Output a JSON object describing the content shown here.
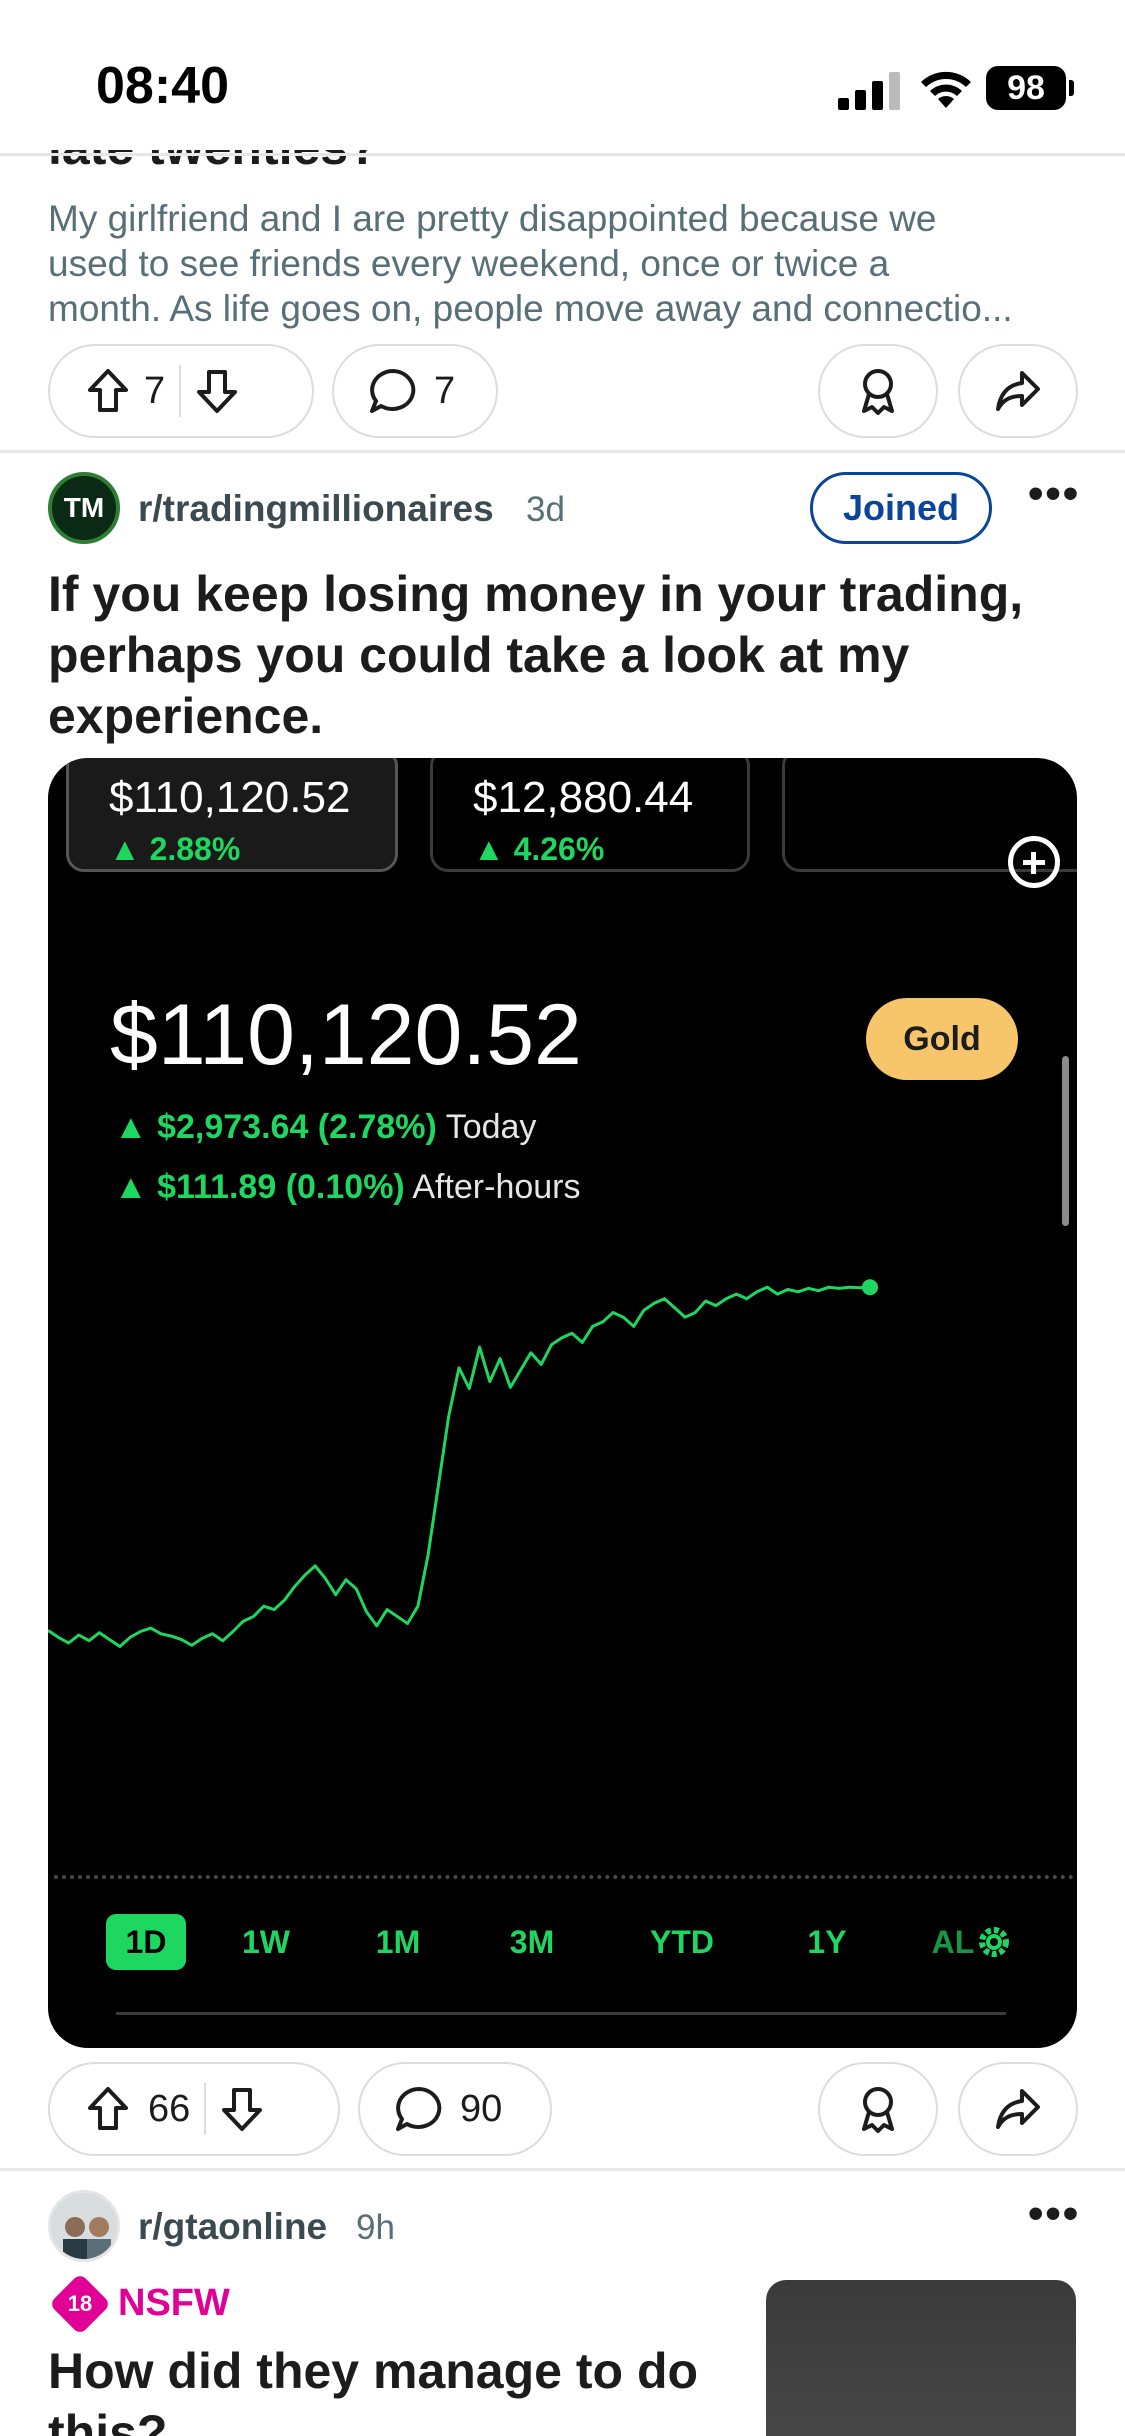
{
  "status_bar": {
    "time": "08:40",
    "battery": "98"
  },
  "post1": {
    "title_fragment": "late twenties?",
    "body_lines": [
      "My girlfriend and I are pretty disappointed because we",
      "used to see friends every weekend, once or twice a",
      "month. As life goes on, people move away and connectio..."
    ],
    "upvotes": "7",
    "comments": "7"
  },
  "post2": {
    "avatar_text": "TM",
    "subreddit": "r/tradingmillionaires",
    "time": "3d",
    "joined_label": "Joined",
    "more": "•••",
    "title": "If you keep losing money in your trading, perhaps you could take a look at my experience.",
    "upvotes": "66",
    "comments": "90",
    "image": {
      "accounts": [
        {
          "value": "$110,120.52",
          "change": "▲ 2.88%"
        },
        {
          "value": "$12,880.44",
          "change": "▲ 4.26%"
        }
      ],
      "balance": "$110,120.52",
      "tier_label": "Gold",
      "today_change": "▲ $2,973.64 (2.78%)",
      "today_label": "Today",
      "afterhours_change": "▲ $111.89 (0.10%)",
      "afterhours_label": "After-hours",
      "ranges": [
        "1D",
        "1W",
        "1M",
        "3M",
        "YTD",
        "1Y",
        "AL"
      ],
      "colors": {
        "up": "#1ed760",
        "gold": "#f7c66b",
        "background": "#000000"
      }
    }
  },
  "post3": {
    "subreddit": "r/gtaonline",
    "time": "9h",
    "more": "•••",
    "nsfw_badge": "18",
    "nsfw_label": "NSFW",
    "title": "How did they manage to do this?"
  },
  "colors": {
    "joined": "#0a449b",
    "nsfw": "#e00096",
    "meta": "#576f76"
  },
  "chart_data": {
    "type": "line",
    "title": "",
    "x": [
      0,
      1,
      2,
      3,
      4,
      5,
      6,
      7,
      8,
      9,
      10,
      11,
      12,
      13,
      14,
      15,
      16,
      17,
      18,
      19,
      20,
      21,
      22,
      23,
      24,
      25,
      26,
      27,
      28,
      29,
      30,
      31,
      32,
      33,
      34,
      35,
      36,
      37,
      38,
      39,
      40,
      41,
      42,
      43,
      44,
      45,
      46,
      47,
      48,
      49,
      50,
      51,
      52,
      53,
      54,
      55,
      56,
      57,
      58,
      59,
      60,
      61,
      62,
      63,
      64,
      65,
      66,
      67,
      68,
      69,
      70,
      71,
      72,
      73,
      74,
      75,
      76,
      77,
      78,
      79,
      80
    ],
    "series": [
      {
        "values": [
          107140,
          107080,
          107030,
          107100,
          107050,
          107120,
          107060,
          107000,
          107080,
          107130,
          107160,
          107110,
          107090,
          107060,
          107010,
          107070,
          107110,
          107050,
          107130,
          107220,
          107260,
          107350,
          107320,
          107400,
          107520,
          107620,
          107700,
          107590,
          107450,
          107580,
          107500,
          107300,
          107180,
          107320,
          107260,
          107200,
          107350,
          107800,
          108400,
          109000,
          109420,
          109240,
          109600,
          109300,
          109500,
          109250,
          109400,
          109550,
          109450,
          109620,
          109680,
          109720,
          109640,
          109780,
          109820,
          109900,
          109860,
          109780,
          109920,
          109980,
          110020,
          109940,
          109860,
          109900,
          110000,
          109960,
          110020,
          110060,
          110020,
          110080,
          110120,
          110060,
          110100,
          110080,
          110110,
          110090,
          110120,
          110110,
          110120,
          110115,
          110120
        ],
        "color": "#1ed760"
      }
    ],
    "ylim": [
      106900,
      110200
    ],
    "grid": false
  }
}
